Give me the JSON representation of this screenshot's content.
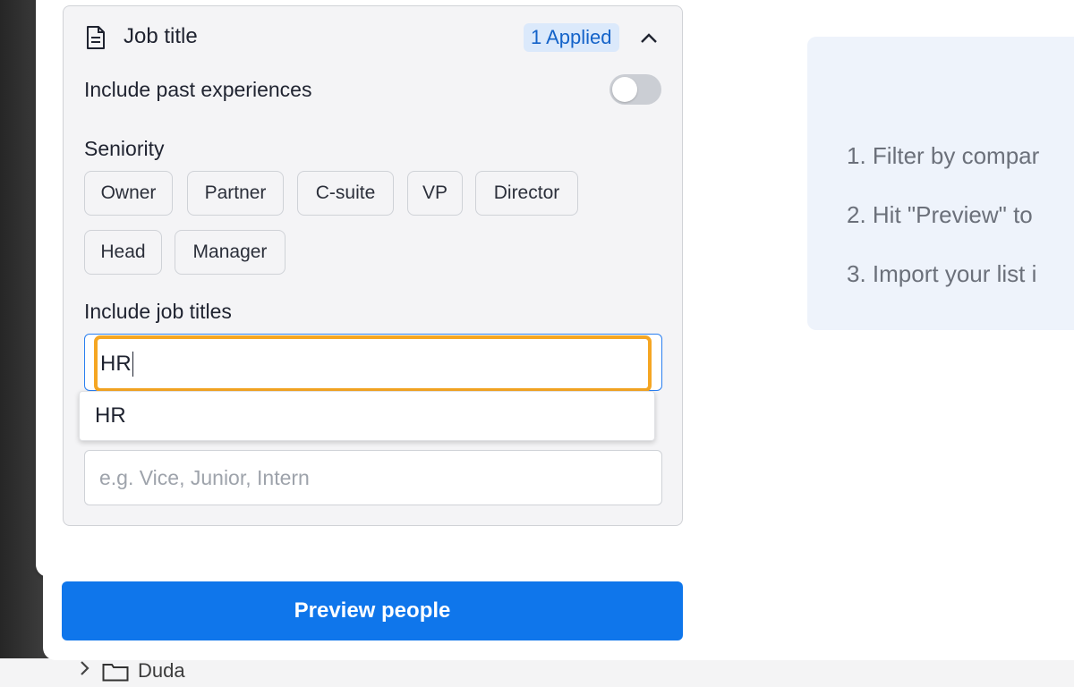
{
  "background": {
    "folder_label": "Duda"
  },
  "filter_card": {
    "title": "Job title",
    "badge": "1 Applied",
    "past_experiences_label": "Include past experiences",
    "past_experiences_on": false,
    "seniority_label": "Seniority",
    "seniority_options": [
      "Owner",
      "Partner",
      "C-suite",
      "VP",
      "Director",
      "Head",
      "Manager"
    ],
    "include_titles_label": "Include job titles",
    "include_titles_value": "HR",
    "suggestions": [
      "HR"
    ],
    "exclude_titles_placeholder": "e.g. Vice, Junior, Intern"
  },
  "preview_button_label": "Preview people",
  "instructions": [
    "1. Filter by compar",
    "2. Hit \"Preview\" to",
    "3. Import your list i"
  ],
  "colors": {
    "primary": "#0f76eb",
    "focus_ring": "#f5a623",
    "badge_bg": "#dbe9fb",
    "badge_text": "#1463c9"
  }
}
